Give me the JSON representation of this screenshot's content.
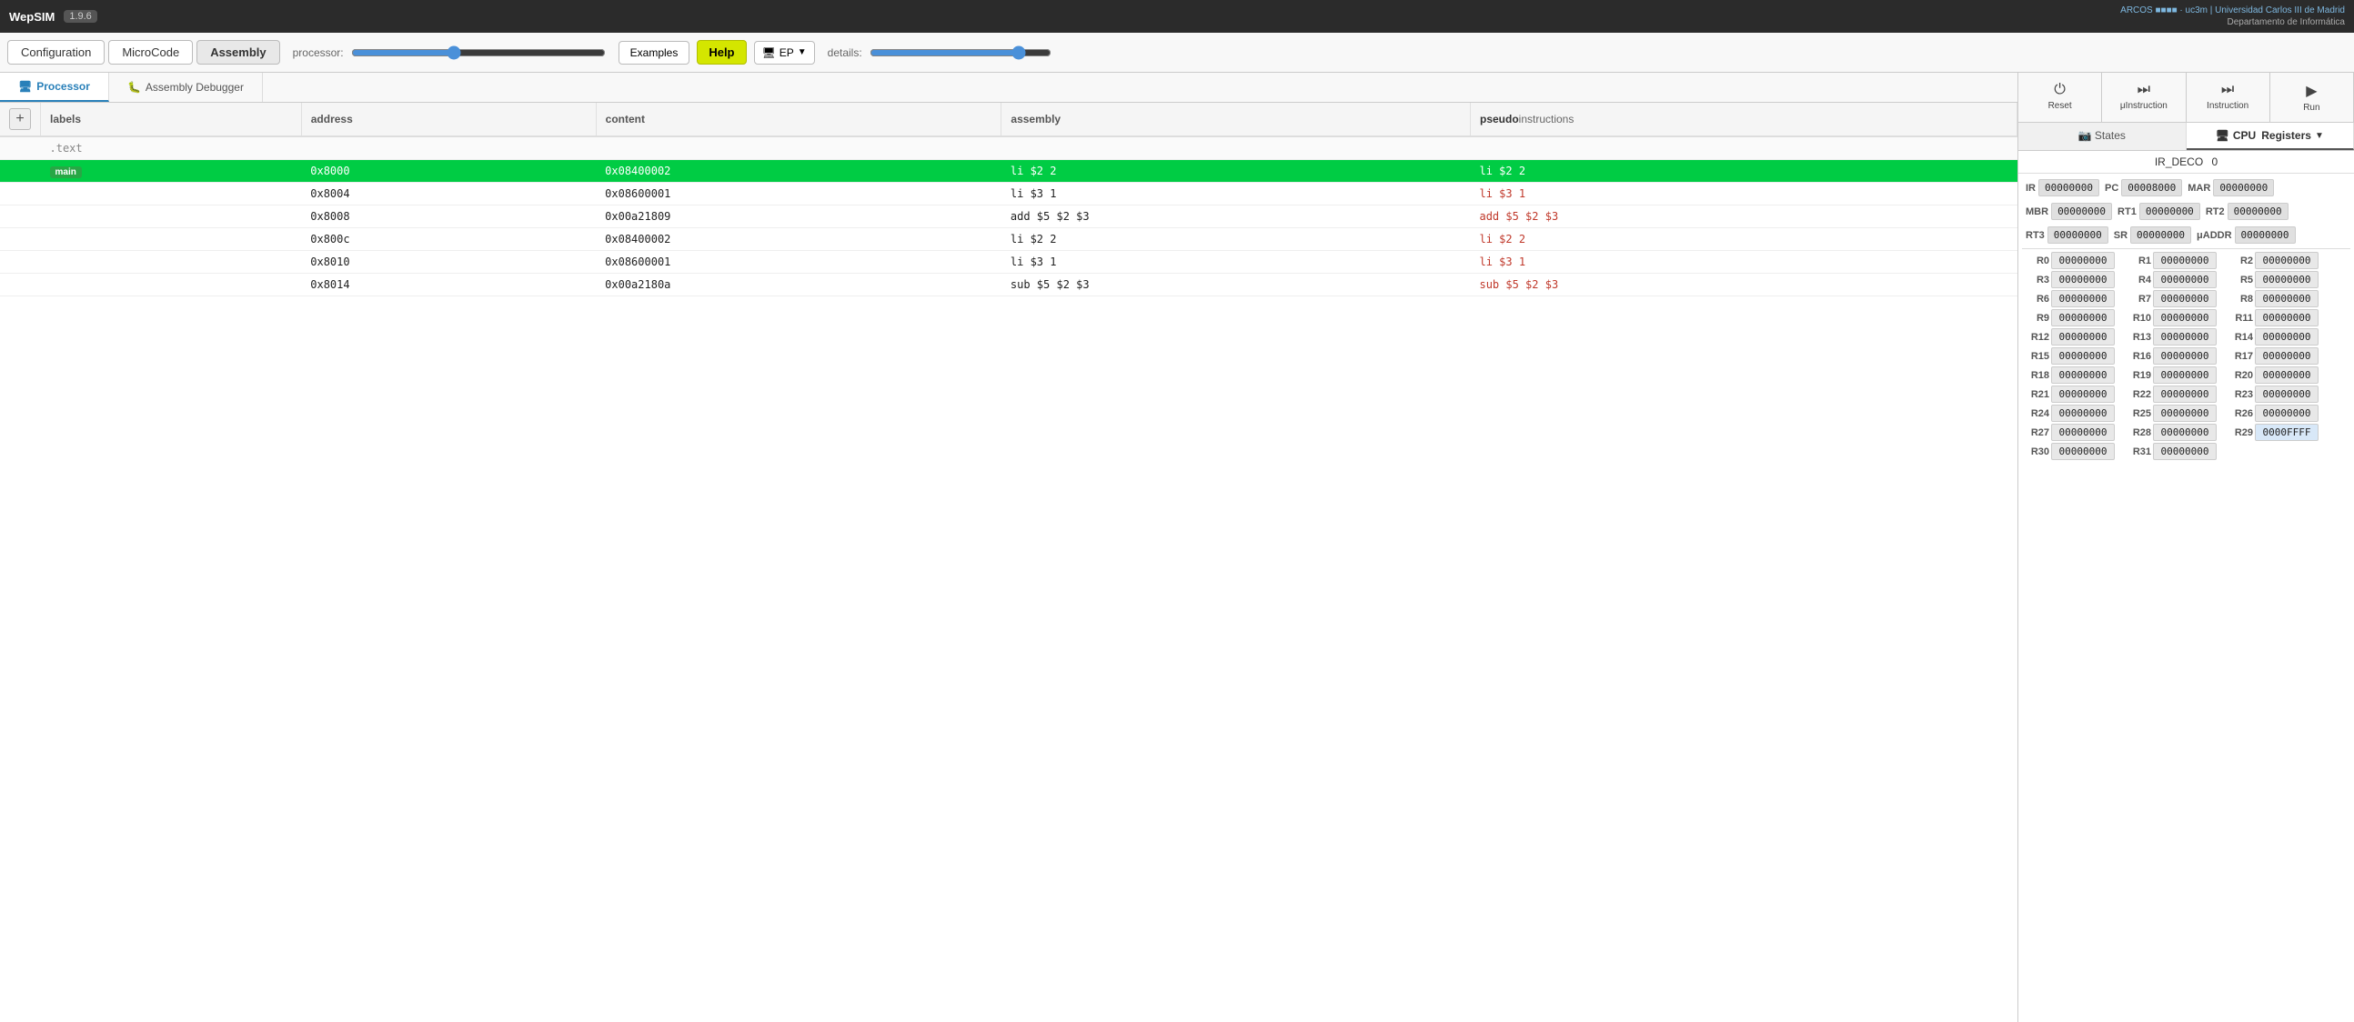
{
  "app": {
    "title": "WepSIM",
    "version": "1.9.6",
    "institution": "ARCOS · uc3m | Universidad Carlos III de Madrid\nDepartamento de Informática"
  },
  "navbar": {
    "tabs": [
      {
        "id": "configuration",
        "label": "Configuration",
        "active": false
      },
      {
        "id": "microcode",
        "label": "MicroCode",
        "active": false
      },
      {
        "id": "assembly",
        "label": "Assembly",
        "active": true
      }
    ],
    "processor_label": "processor:",
    "examples_label": "Examples",
    "help_label": "Help",
    "ep_label": "EP",
    "details_label": "details:"
  },
  "view_tabs": {
    "processor_label": "Processor",
    "debugger_label": "Assembly Debugger"
  },
  "table": {
    "headers": {
      "labels": "labels",
      "address": "address",
      "content": "content",
      "assembly": "assembly",
      "pseudo_bold": "pseudo",
      "pseudo_light": "instructions"
    },
    "section": ".text",
    "rows": [
      {
        "label": "main",
        "address": "0x8000",
        "content": "0x08400002",
        "assembly": "li $2 2",
        "pseudo": "li $2 2",
        "highlighted": true
      },
      {
        "label": "",
        "address": "0x8004",
        "content": "0x08600001",
        "assembly": "li $3 1",
        "pseudo": "li $3 1",
        "highlighted": false
      },
      {
        "label": "",
        "address": "0x8008",
        "content": "0x00a21809",
        "assembly": "add $5 $2 $3",
        "pseudo": "add $5 $2 $3",
        "highlighted": false
      },
      {
        "label": "",
        "address": "0x800c",
        "content": "0x08400002",
        "assembly": "li $2 2",
        "pseudo": "li $2 2",
        "highlighted": false
      },
      {
        "label": "",
        "address": "0x8010",
        "content": "0x08600001",
        "assembly": "li $3 1",
        "pseudo": "li $3 1",
        "highlighted": false
      },
      {
        "label": "",
        "address": "0x8014",
        "content": "0x00a2180a",
        "assembly": "sub $5 $2 $3",
        "pseudo": "sub $5 $2 $3",
        "highlighted": false
      }
    ]
  },
  "control": {
    "reset_label": "Reset",
    "uinstruction_label": "μInstruction",
    "instruction_label": "Instruction",
    "run_label": "Run"
  },
  "state_tabs": {
    "states_label": "States",
    "registers_label": "Registers",
    "cpu_label": "CPU"
  },
  "ir_deco": {
    "label": "IR_DECO",
    "value": "0"
  },
  "special_regs": [
    {
      "name": "IR",
      "value": "00000000"
    },
    {
      "name": "PC",
      "value": "00008000"
    },
    {
      "name": "MAR",
      "value": "00000000"
    },
    {
      "name": "MBR",
      "value": "00000000"
    },
    {
      "name": "RT1",
      "value": "00000000"
    },
    {
      "name": "RT2",
      "value": "00000000"
    },
    {
      "name": "RT3",
      "value": "00000000"
    },
    {
      "name": "SR",
      "value": "00000000"
    },
    {
      "name": "μADDR",
      "value": "00000000"
    }
  ],
  "registers": [
    {
      "name": "R0",
      "value": "00000000"
    },
    {
      "name": "R1",
      "value": "00000000"
    },
    {
      "name": "R2",
      "value": "00000000"
    },
    {
      "name": "R3",
      "value": "00000000"
    },
    {
      "name": "R4",
      "value": "00000000"
    },
    {
      "name": "R5",
      "value": "00000000"
    },
    {
      "name": "R6",
      "value": "00000000"
    },
    {
      "name": "R7",
      "value": "00000000"
    },
    {
      "name": "R8",
      "value": "00000000"
    },
    {
      "name": "R9",
      "value": "00000000"
    },
    {
      "name": "R10",
      "value": "00000000"
    },
    {
      "name": "R11",
      "value": "00000000"
    },
    {
      "name": "R12",
      "value": "00000000"
    },
    {
      "name": "R13",
      "value": "00000000"
    },
    {
      "name": "R14",
      "value": "00000000"
    },
    {
      "name": "R15",
      "value": "00000000"
    },
    {
      "name": "R16",
      "value": "00000000"
    },
    {
      "name": "R17",
      "value": "00000000"
    },
    {
      "name": "R18",
      "value": "00000000"
    },
    {
      "name": "R19",
      "value": "00000000"
    },
    {
      "name": "R20",
      "value": "00000000"
    },
    {
      "name": "R21",
      "value": "00000000"
    },
    {
      "name": "R22",
      "value": "00000000"
    },
    {
      "name": "R23",
      "value": "00000000"
    },
    {
      "name": "R24",
      "value": "00000000"
    },
    {
      "name": "R25",
      "value": "00000000"
    },
    {
      "name": "R26",
      "value": "00000000"
    },
    {
      "name": "R27",
      "value": "00000000"
    },
    {
      "name": "R28",
      "value": "00000000"
    },
    {
      "name": "R29",
      "value": "0000FFFF"
    },
    {
      "name": "R30",
      "value": "00000000"
    },
    {
      "name": "R31",
      "value": "00000000"
    }
  ]
}
